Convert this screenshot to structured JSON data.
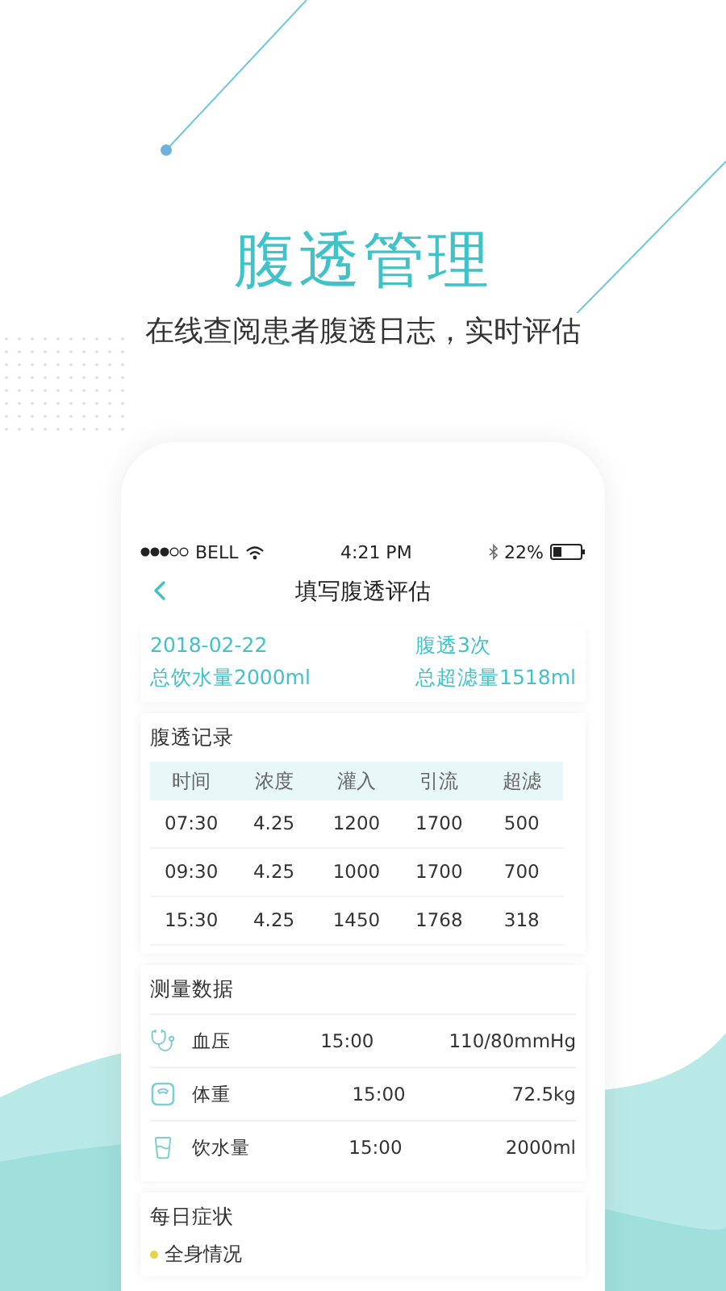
{
  "hero": {
    "title": "腹透管理",
    "subtitle": "在线查阅患者腹透日志，实时评估"
  },
  "status_bar": {
    "carrier": "BELL",
    "time": "4:21 PM",
    "battery": "22%"
  },
  "nav": {
    "title": "填写腹透评估"
  },
  "summary": {
    "date": "2018-02-22",
    "sessions": "腹透3次",
    "water": "总饮水量2000ml",
    "ultrafiltration": "总超滤量1518ml"
  },
  "records": {
    "title": "腹透记录",
    "columns": [
      "时间",
      "浓度",
      "灌入",
      "引流",
      "超滤"
    ],
    "rows": [
      [
        "07:30",
        "4.25",
        "1200",
        "1700",
        "500"
      ],
      [
        "09:30",
        "4.25",
        "1000",
        "1700",
        "700"
      ],
      [
        "15:30",
        "4.25",
        "1450",
        "1768",
        "318"
      ]
    ]
  },
  "measurements": {
    "title": "测量数据",
    "items": [
      {
        "kind": "blood_pressure",
        "name": "血压",
        "time": "15:00",
        "value": "110/80mmHg"
      },
      {
        "kind": "weight",
        "name": "体重",
        "time": "15:00",
        "value": "72.5kg"
      },
      {
        "kind": "water",
        "name": "饮水量",
        "time": "15:00",
        "value": "2000ml"
      }
    ]
  },
  "symptoms": {
    "title": "每日症状",
    "items": [
      {
        "label": "全身情况"
      }
    ]
  }
}
